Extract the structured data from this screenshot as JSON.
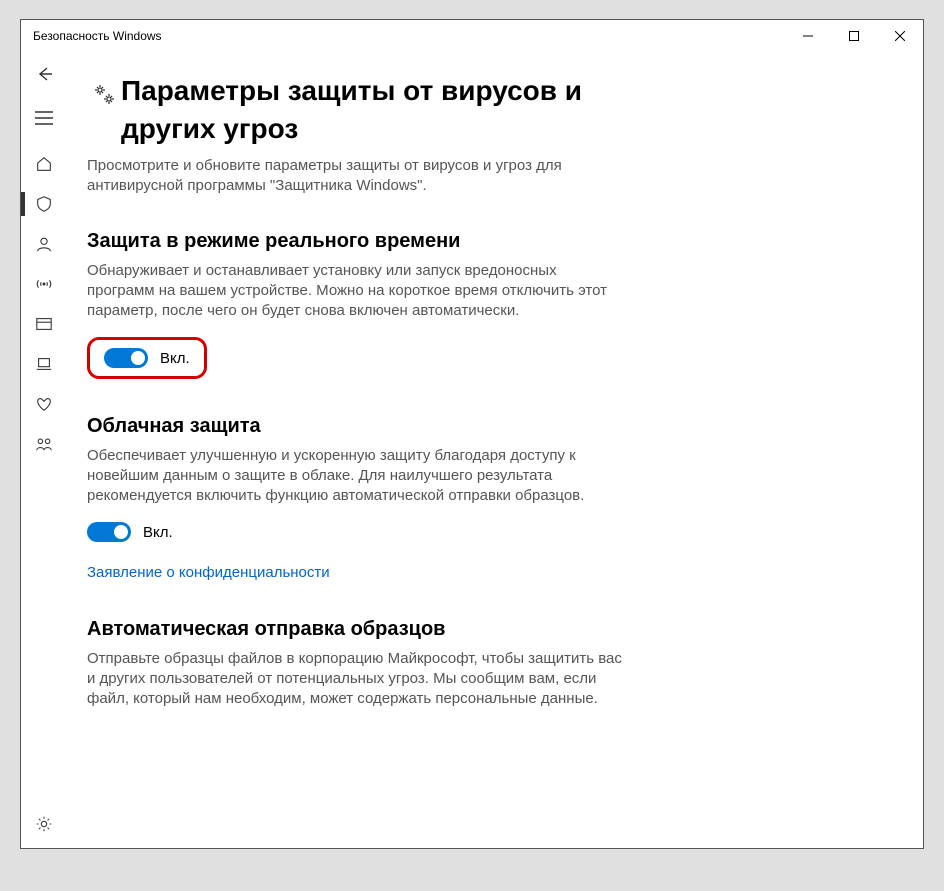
{
  "window": {
    "title": "Безопасность Windows"
  },
  "page": {
    "title": "Параметры защиты от вирусов и других угроз",
    "description": "Просмотрите и обновите параметры защиты от вирусов и угроз для антивирусной программы \"Защитника Windows\"."
  },
  "sections": {
    "realtime": {
      "title": "Защита в режиме реального времени",
      "description": "Обнаруживает и останавливает установку или запуск вредоносных программ на вашем устройстве. Можно на короткое время отключить этот параметр, после чего он будет снова включен автоматически.",
      "toggle_label": "Вкл."
    },
    "cloud": {
      "title": "Облачная защита",
      "description": "Обеспечивает улучшенную и ускоренную защиту благодаря доступу к новейшим данным о защите в облаке. Для наилучшего результата рекомендуется включить функцию автоматической отправки образцов.",
      "toggle_label": "Вкл.",
      "privacy_link": "Заявление о конфиденциальности"
    },
    "samples": {
      "title": "Автоматическая отправка образцов",
      "description": "Отправьте образцы файлов в корпорацию Майкрософт, чтобы защитить вас и других пользователей от потенциальных угроз. Мы сообщим вам, если файл, который нам необходим, может содержать персональные данные."
    }
  }
}
